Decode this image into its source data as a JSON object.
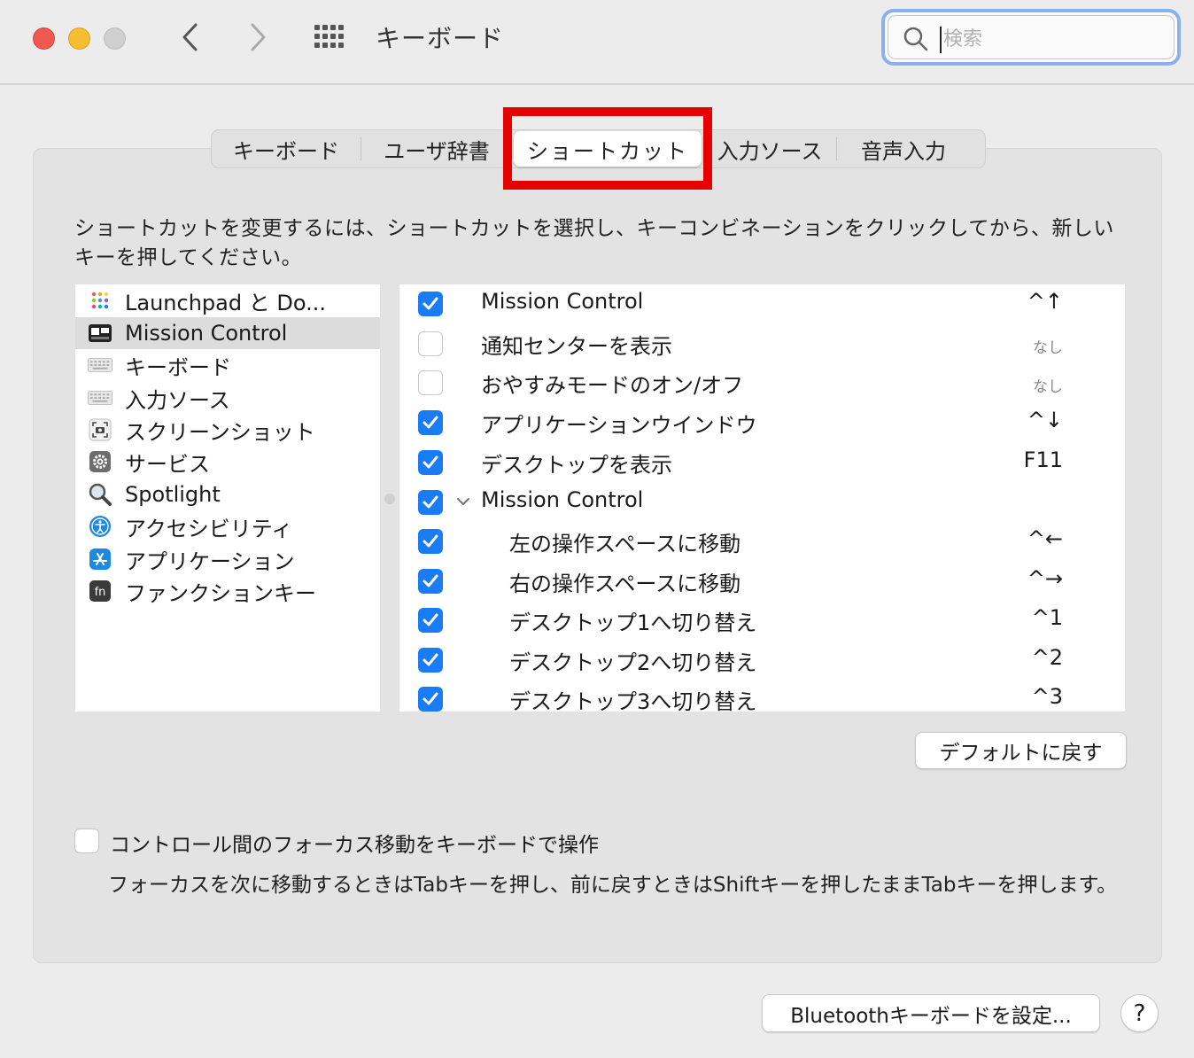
{
  "window": {
    "title": "キーボード",
    "search_placeholder": "検索"
  },
  "tabs": [
    {
      "label": "キーボード"
    },
    {
      "label": "ユーザ辞書"
    },
    {
      "label": "ショートカット",
      "active": true
    },
    {
      "label": "入力ソース"
    },
    {
      "label": "音声入力"
    }
  ],
  "highlight_color": "#e60000",
  "accent_color": "#1a7cf5",
  "instructions": "ショートカットを変更するには、ショートカットを選択し、キーコンビネーションをクリックしてから、新しいキーを押してください。",
  "sidebar": {
    "items": [
      {
        "label": "Launchpad と Do...",
        "icon": "launchpad-icon"
      },
      {
        "label": "Mission Control",
        "icon": "mission-control-icon",
        "selected": true
      },
      {
        "label": "キーボード",
        "icon": "keyboard-icon"
      },
      {
        "label": "入力ソース",
        "icon": "input-source-icon"
      },
      {
        "label": "スクリーンショット",
        "icon": "screenshot-icon"
      },
      {
        "label": "サービス",
        "icon": "gear-icon"
      },
      {
        "label": "Spotlight",
        "icon": "magnifier-icon"
      },
      {
        "label": "アクセシビリティ",
        "icon": "accessibility-icon"
      },
      {
        "label": "アプリケーション",
        "icon": "app-store-icon"
      },
      {
        "label": "ファンクションキー",
        "icon": "fn-key-icon"
      }
    ]
  },
  "shortcuts": [
    {
      "label": "Mission Control",
      "key": "^↑",
      "checked": true
    },
    {
      "label": "通知センターを表示",
      "key": "なし",
      "checked": false
    },
    {
      "label": "おやすみモードのオン/オフ",
      "key": "なし",
      "checked": false
    },
    {
      "label": "アプリケーションウインドウ",
      "key": "^↓",
      "checked": true
    },
    {
      "label": "デスクトップを表示",
      "key": "F11",
      "checked": true
    },
    {
      "label": "Mission Control",
      "key": "",
      "checked": true,
      "group": true
    },
    {
      "label": "左の操作スペースに移動",
      "key": "^←",
      "checked": true
    },
    {
      "label": "右の操作スペースに移動",
      "key": "^→",
      "checked": true
    },
    {
      "label": "デスクトップ1へ切り替え",
      "key": "^1",
      "checked": true
    },
    {
      "label": "デスクトップ2へ切り替え",
      "key": "^2",
      "checked": true
    },
    {
      "label": "デスクトップ3へ切り替え",
      "key": "^3",
      "checked": true
    }
  ],
  "default_button": "デフォルトに戻す",
  "keyboard_navigation": {
    "label": "コントロール間のフォーカス移動をキーボードで操作",
    "checked": false,
    "description": "フォーカスを次に移動するときはTabキーを押し、前に戻すときはShiftキーを押したままTabキーを押します。"
  },
  "bluetooth_button": "Bluetoothキーボードを設定...",
  "help_button": "?"
}
